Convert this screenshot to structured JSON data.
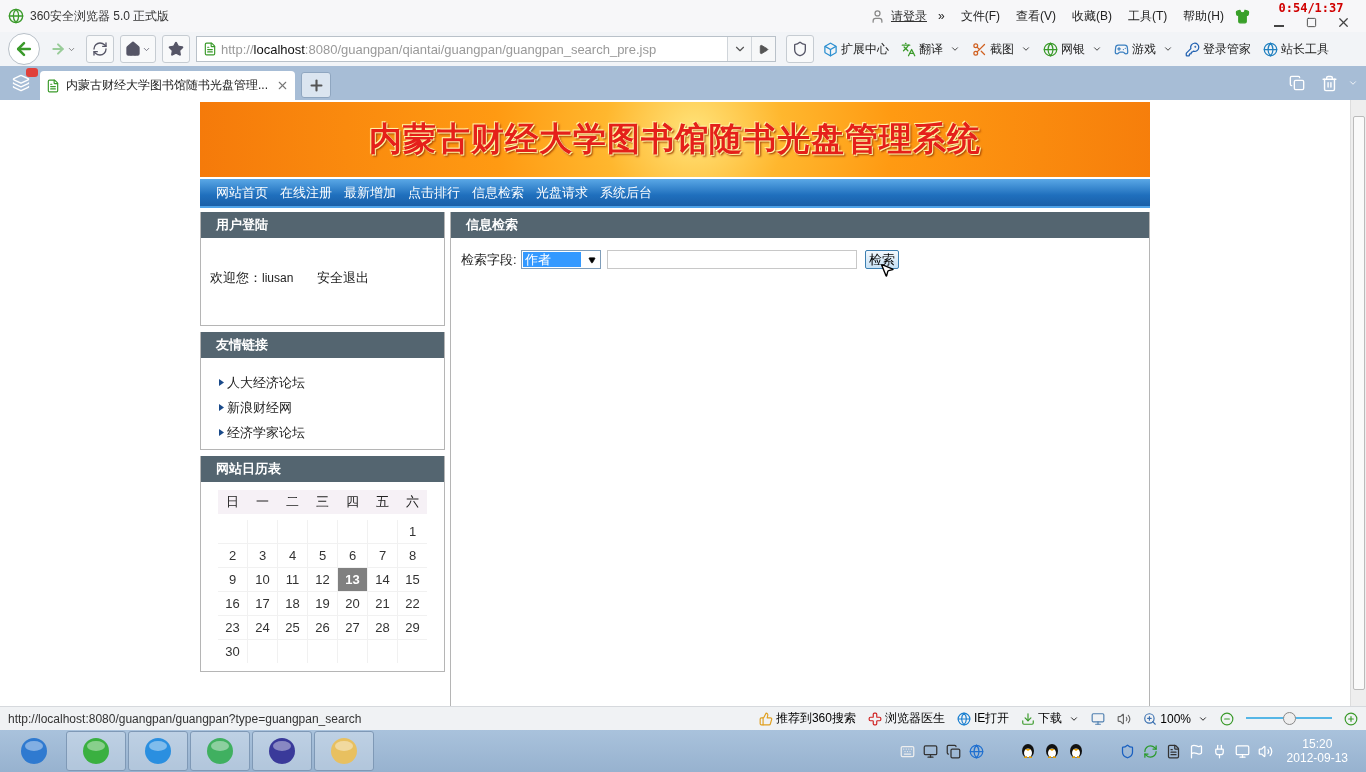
{
  "browser": {
    "title": "360安全浏览器 5.0 正式版",
    "login": "请登录",
    "chevron": "»",
    "menus": [
      "文件(F)",
      "查看(V)",
      "收藏(B)",
      "工具(T)",
      "帮助(H)"
    ],
    "recording_timer": "0:54/1:37",
    "address": {
      "scheme": "http://",
      "host": "localhost",
      "path": ":8080/guangpan/qiantai/guangpan/guangpan_search_pre.jsp"
    },
    "toolbar_items": [
      {
        "label": "扩展中心",
        "kind": "extensions",
        "dropdown": false
      },
      {
        "label": "翻译",
        "kind": "translate",
        "dropdown": true
      },
      {
        "label": "截图",
        "kind": "screenshot",
        "dropdown": true
      },
      {
        "label": "网银",
        "kind": "bank",
        "dropdown": true
      },
      {
        "label": "游戏",
        "kind": "games",
        "dropdown": true
      },
      {
        "label": "登录管家",
        "kind": "key",
        "dropdown": false
      },
      {
        "label": "站长工具",
        "kind": "webmaster",
        "dropdown": false
      }
    ],
    "tabs": [
      {
        "label": "内蒙古财经大学图书馆随书光盘管理...",
        "selected": true
      }
    ]
  },
  "page": {
    "banner_title": "内蒙古财经大学图书馆随书光盘管理系统",
    "nav": [
      "网站首页",
      "在线注册",
      "最新增加",
      "点击排行",
      "信息检索",
      "光盘请求",
      "系统后台"
    ],
    "login_panel": {
      "title": "用户登陆",
      "welcome": "欢迎您：",
      "username": "liusan",
      "logout": "安全退出"
    },
    "links_panel": {
      "title": "友情链接",
      "links": [
        "人大经济论坛",
        "新浪财经网",
        "经济学家论坛"
      ]
    },
    "calendar": {
      "title": "网站日历表",
      "weekdays": [
        "日",
        "一",
        "二",
        "三",
        "四",
        "五",
        "六"
      ],
      "weeks": [
        [
          {
            "kind": "blank"
          },
          {
            "kind": "blank"
          },
          {
            "kind": "blank"
          },
          {
            "kind": "blank"
          },
          {
            "kind": "blank"
          },
          {
            "kind": "blank"
          },
          {
            "kind": "day",
            "day": "1",
            "selected": false
          }
        ],
        [
          {
            "kind": "day",
            "day": "2",
            "selected": false
          },
          {
            "kind": "day",
            "day": "3",
            "selected": false
          },
          {
            "kind": "day",
            "day": "4",
            "selected": false
          },
          {
            "kind": "day",
            "day": "5",
            "selected": false
          },
          {
            "kind": "day",
            "day": "6",
            "selected": false
          },
          {
            "kind": "day",
            "day": "7",
            "selected": false
          },
          {
            "kind": "day",
            "day": "8",
            "selected": false
          }
        ],
        [
          {
            "kind": "day",
            "day": "9",
            "selected": false
          },
          {
            "kind": "day",
            "day": "10",
            "selected": false
          },
          {
            "kind": "day",
            "day": "11",
            "selected": false
          },
          {
            "kind": "day",
            "day": "12",
            "selected": false
          },
          {
            "kind": "day",
            "day": "13",
            "selected": true
          },
          {
            "kind": "day",
            "day": "14",
            "selected": false
          },
          {
            "kind": "day",
            "day": "15",
            "selected": false
          }
        ],
        [
          {
            "kind": "day",
            "day": "16",
            "selected": false
          },
          {
            "kind": "day",
            "day": "17",
            "selected": false
          },
          {
            "kind": "day",
            "day": "18",
            "selected": false
          },
          {
            "kind": "day",
            "day": "19",
            "selected": false
          },
          {
            "kind": "day",
            "day": "20",
            "selected": false
          },
          {
            "kind": "day",
            "day": "21",
            "selected": false
          },
          {
            "kind": "day",
            "day": "22",
            "selected": false
          }
        ],
        [
          {
            "kind": "day",
            "day": "23",
            "selected": false
          },
          {
            "kind": "day",
            "day": "24",
            "selected": false
          },
          {
            "kind": "day",
            "day": "25",
            "selected": false
          },
          {
            "kind": "day",
            "day": "26",
            "selected": false
          },
          {
            "kind": "day",
            "day": "27",
            "selected": false
          },
          {
            "kind": "day",
            "day": "28",
            "selected": false
          },
          {
            "kind": "day",
            "day": "29",
            "selected": false
          }
        ],
        [
          {
            "kind": "day",
            "day": "30",
            "selected": false
          },
          {
            "kind": "blank"
          },
          {
            "kind": "blank"
          },
          {
            "kind": "blank"
          },
          {
            "kind": "blank"
          },
          {
            "kind": "blank"
          },
          {
            "kind": "blank"
          }
        ]
      ]
    },
    "search": {
      "title": "信息检索",
      "field_label": "检索字段:",
      "field_value": "作者",
      "button": "检索"
    }
  },
  "status_bar": {
    "url": "http://localhost:8080/guangpan/guangpan?type=guangpan_search",
    "items": [
      {
        "label": "推荐到360搜索",
        "kind": "thumb"
      },
      {
        "label": "浏览器医生",
        "kind": "doctor"
      },
      {
        "label": "IE打开",
        "kind": "ie"
      },
      {
        "label": "下载",
        "kind": "download"
      }
    ],
    "zoom": "100%",
    "zoom_slider": {
      "level": 0.5
    }
  },
  "taskbar": {
    "time": "15:20",
    "date": "2012-09-13"
  }
}
